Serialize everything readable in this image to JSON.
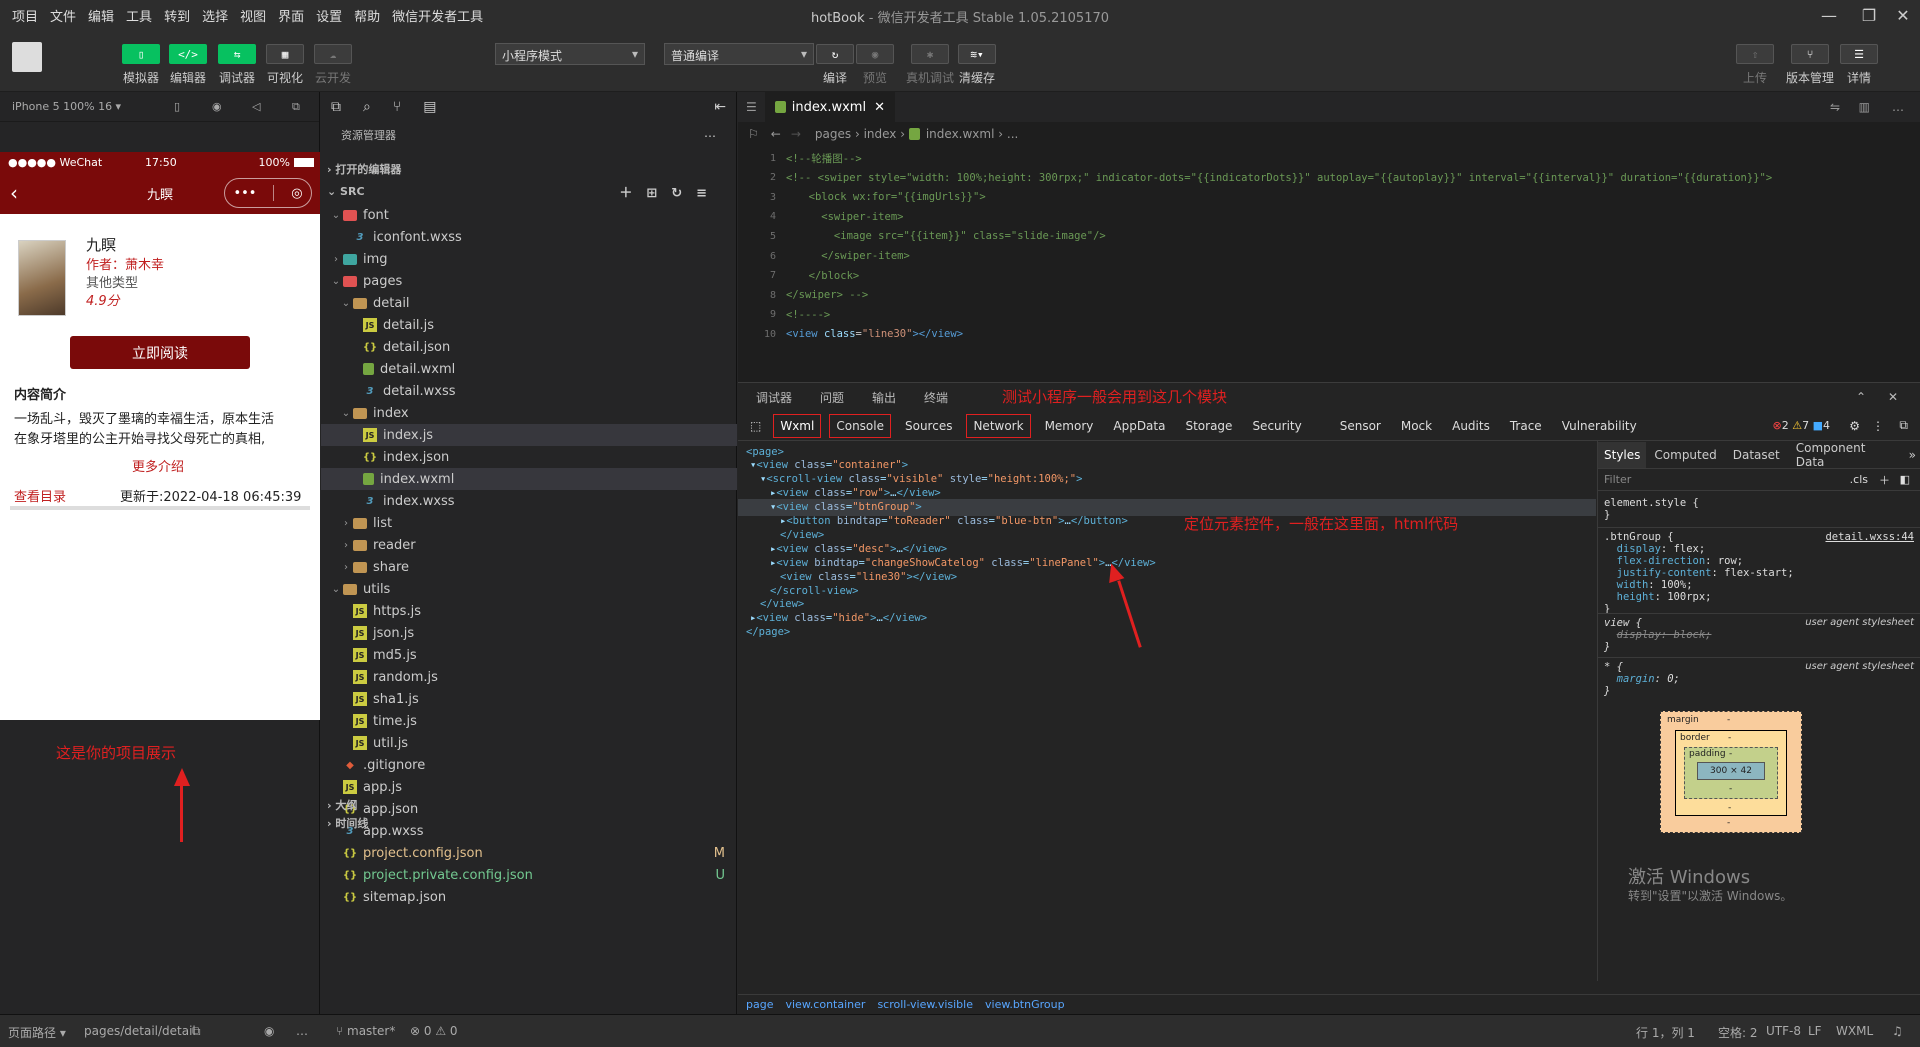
{
  "menu": [
    "项目",
    "文件",
    "编辑",
    "工具",
    "转到",
    "选择",
    "视图",
    "界面",
    "设置",
    "帮助",
    "微信开发者工具"
  ],
  "window": {
    "app_name": "hotBook",
    "subtitle": "微信开发者工具 Stable 1.05.2105170"
  },
  "toolbar": {
    "simulator": "模拟器",
    "editor": "编辑器",
    "debugger": "调试器",
    "visual": "可视化",
    "cloud": "云开发",
    "mode_select": "小程序模式",
    "compile_select": "普通编译",
    "compile": "编译",
    "preview": "预览",
    "real_debug": "真机调试",
    "clear_cache": "清缓存",
    "upload": "上传",
    "version": "版本管理",
    "details": "详情"
  },
  "simulator": {
    "device": "iPhone 5 100% 16 ▾",
    "status_carrier": "●●●●● WeChat",
    "status_time": "17:50",
    "status_battery": "100%",
    "nav_title": "九瞑",
    "book_title": "九瞑",
    "author_label": "作者：",
    "author_name": "萧木幸",
    "category": "其他类型",
    "score": "4.9分",
    "read_button": "立即阅读",
    "intro_heading": "内容简介",
    "intro_line1": "一场乱斗，毁灭了墨璃的幸福生活，原本生活",
    "intro_line2": "在象牙塔里的公主开始寻找父母死亡的真相,",
    "more": "更多介绍",
    "catalog": "查看目录",
    "updated": "更新于:2022-04-18 06:45:39"
  },
  "explorer": {
    "title": "资源管理器",
    "open_editors": "打开的编辑器",
    "root": "SRC",
    "outline": "大纲",
    "timeline": "时间线",
    "items": [
      {
        "name": "font",
        "kind": "folder-red",
        "depth": 1,
        "open": true
      },
      {
        "name": "iconfont.wxss",
        "kind": "wxss",
        "depth": 2
      },
      {
        "name": "img",
        "kind": "folder-teal",
        "depth": 1,
        "open": false
      },
      {
        "name": "pages",
        "kind": "folder-red",
        "depth": 1,
        "open": true
      },
      {
        "name": "detail",
        "kind": "folder",
        "depth": 2,
        "open": true
      },
      {
        "name": "detail.js",
        "kind": "js",
        "depth": 3
      },
      {
        "name": "detail.json",
        "kind": "json",
        "depth": 3
      },
      {
        "name": "detail.wxml",
        "kind": "wxml",
        "depth": 3
      },
      {
        "name": "detail.wxss",
        "kind": "wxss",
        "depth": 3
      },
      {
        "name": "index",
        "kind": "folder",
        "depth": 2,
        "open": true
      },
      {
        "name": "index.js",
        "kind": "js",
        "depth": 3,
        "active": true
      },
      {
        "name": "index.json",
        "kind": "json",
        "depth": 3
      },
      {
        "name": "index.wxml",
        "kind": "wxml",
        "depth": 3,
        "active": true
      },
      {
        "name": "index.wxss",
        "kind": "wxss",
        "depth": 3
      },
      {
        "name": "list",
        "kind": "folder",
        "depth": 2,
        "open": false
      },
      {
        "name": "reader",
        "kind": "folder",
        "depth": 2,
        "open": false
      },
      {
        "name": "share",
        "kind": "folder",
        "depth": 2,
        "open": false
      },
      {
        "name": "utils",
        "kind": "folder",
        "depth": 1,
        "open": true
      },
      {
        "name": "https.js",
        "kind": "js",
        "depth": 2
      },
      {
        "name": "json.js",
        "kind": "js",
        "depth": 2
      },
      {
        "name": "md5.js",
        "kind": "js",
        "depth": 2
      },
      {
        "name": "random.js",
        "kind": "js",
        "depth": 2
      },
      {
        "name": "sha1.js",
        "kind": "js",
        "depth": 2
      },
      {
        "name": "time.js",
        "kind": "js",
        "depth": 2
      },
      {
        "name": "util.js",
        "kind": "js",
        "depth": 2
      },
      {
        "name": ".gitignore",
        "kind": "git",
        "depth": 1
      },
      {
        "name": "app.js",
        "kind": "js",
        "depth": 1
      },
      {
        "name": "app.json",
        "kind": "json",
        "depth": 1
      },
      {
        "name": "app.wxss",
        "kind": "wxss",
        "depth": 1
      },
      {
        "name": "project.config.json",
        "kind": "json",
        "depth": 1,
        "badge": "M",
        "color": "#e2c08d"
      },
      {
        "name": "project.private.config.json",
        "kind": "json",
        "depth": 1,
        "badge": "U",
        "color": "#73c991"
      },
      {
        "name": "sitemap.json",
        "kind": "json",
        "depth": 1
      }
    ]
  },
  "editor": {
    "tab": "index.wxml",
    "breadcrumb": [
      "pages",
      "index",
      "index.wxml",
      "..."
    ],
    "lines": [
      {
        "n": "1",
        "html": "<span class='cm'>&lt;!--轮播图--&gt;</span>",
        "indent": 0
      },
      {
        "n": "2",
        "html": "<span class='cm'>&lt;!-- &lt;swiper style=\"width: 100%;height: 300rpx;\" indicator-dots=\"{{indicatorDots}}\" autoplay=\"{{autoplay}}\" interval=\"{{interval}}\" duration=\"{{duration}}\"&gt;</span>",
        "indent": 0
      },
      {
        "n": "3",
        "html": "<span class='cm'>  &lt;block wx:for=\"{{imgUrls}}\"&gt;</span>",
        "indent": 1
      },
      {
        "n": "4",
        "html": "<span class='cm'>    &lt;swiper-item&gt;</span>",
        "indent": 1
      },
      {
        "n": "5",
        "html": "<span class='cm'>      &lt;image src=\"{{item}}\" class=\"slide-image\"/&gt;</span>",
        "indent": 1
      },
      {
        "n": "6",
        "html": "<span class='cm'>    &lt;/swiper-item&gt;</span>",
        "indent": 1
      },
      {
        "n": "7",
        "html": "<span class='cm'>  &lt;/block&gt;</span>",
        "indent": 1
      },
      {
        "n": "8",
        "html": "<span class='cm'>&lt;/swiper&gt; --&gt;</span>",
        "indent": 0
      },
      {
        "n": "9",
        "html": "<span class='cm'>&lt;!----&gt;</span>",
        "indent": 0
      },
      {
        "n": "10",
        "html": "<span class='tg'>&lt;view</span> <span class='at'>class</span>=<span class='st'>\"line30\"</span><span class='tg'>&gt;&lt;/view&gt;</span>",
        "indent": 0
      }
    ]
  },
  "devtools": {
    "top_tabs": [
      "调试器",
      "问题",
      "输出",
      "终端"
    ],
    "tabs": [
      "Wxml",
      "Console",
      "Sources",
      "Network",
      "Memory",
      "AppData",
      "Storage",
      "Security",
      "Sensor",
      "Mock",
      "Audits",
      "Trace",
      "Vulnerability"
    ],
    "errors": "2",
    "warnings": "7",
    "infos": "4",
    "style_tabs": [
      "Styles",
      "Computed",
      "Dataset",
      "Component Data"
    ],
    "filter_placeholder": "Filter",
    "cls": ".cls",
    "source_link": "detail.wxss:44",
    "ua1": "user agent stylesheet",
    "ua2": "user agent stylesheet",
    "box": {
      "margin": "margin",
      "border": "border",
      "padding": "padding",
      "size": "300 × 42",
      "dash": "-"
    },
    "path": [
      "page",
      "view.container",
      "scroll-view.visible",
      "view.btnGroup"
    ]
  },
  "annotations": {
    "modules": "测试小程序一般会用到这几个模块",
    "locate": "定位元素控件，一般在这里面，html代码",
    "project": "这是你的项目展示"
  },
  "watermark": {
    "line1": "激活 Windows",
    "line2": "转到\"设置\"以激活 Windows。"
  },
  "statusbar": {
    "page_path_label": "页面路径 ▾",
    "page_path": "pages/detail/detail",
    "branch": "master*",
    "problems": "⊗ 0 ⚠ 0",
    "cursor": "行 1，列 1",
    "spaces": "空格: 2",
    "encoding": "UTF-8",
    "eol": "LF",
    "lang": "WXML"
  }
}
